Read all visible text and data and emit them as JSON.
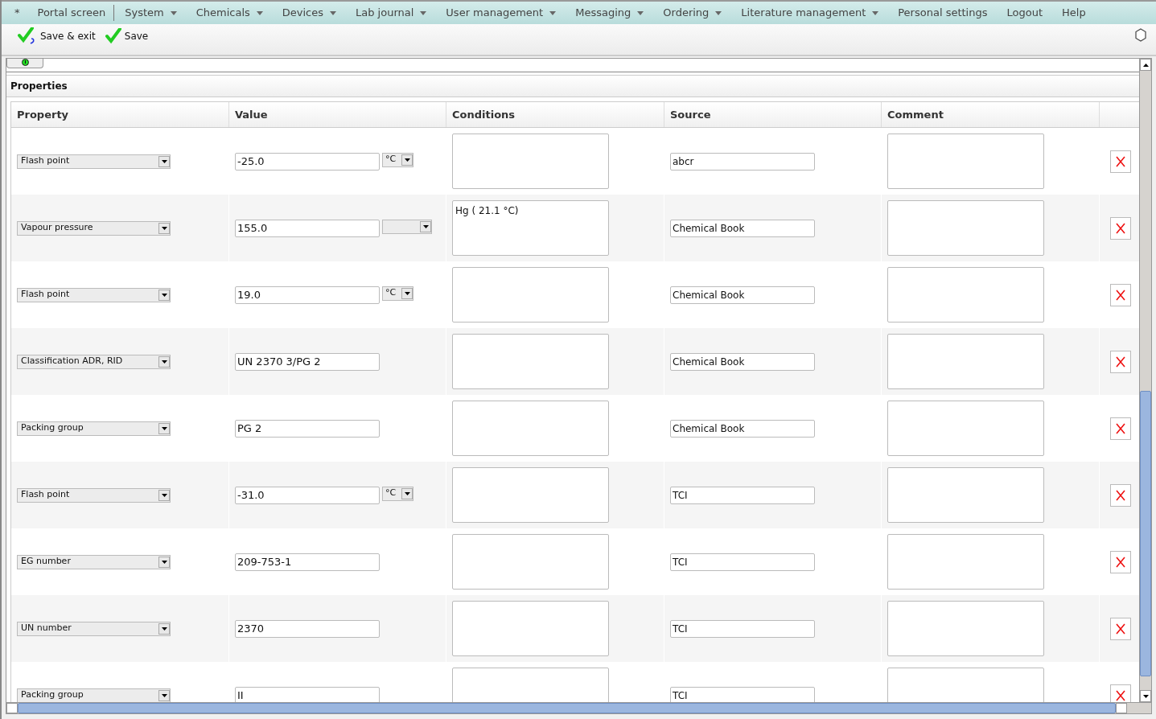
{
  "menu": [
    {
      "label": "*",
      "dropdown": false
    },
    {
      "label": "Portal screen",
      "dropdown": false
    },
    {
      "label": "System",
      "dropdown": true
    },
    {
      "label": "Chemicals",
      "dropdown": true
    },
    {
      "label": "Devices",
      "dropdown": true
    },
    {
      "label": "Lab journal",
      "dropdown": true
    },
    {
      "label": "User management",
      "dropdown": true
    },
    {
      "label": "Messaging",
      "dropdown": true
    },
    {
      "label": "Ordering",
      "dropdown": true
    },
    {
      "label": "Literature management",
      "dropdown": true
    },
    {
      "label": "Personal settings",
      "dropdown": false
    },
    {
      "label": "Logout",
      "dropdown": false
    },
    {
      "label": "Help",
      "dropdown": false
    }
  ],
  "toolbar": [
    {
      "label": "Save & exit",
      "kind": "save-exit"
    },
    {
      "label": "Save",
      "kind": "save"
    }
  ],
  "section": {
    "title": "Properties"
  },
  "table": {
    "columns": [
      "Property",
      "Value",
      "Conditions",
      "Source",
      "Comment"
    ],
    "rows": [
      {
        "property": "Flash point",
        "value": "-25.0",
        "unit_field": true,
        "unit": "°C",
        "source": "abcr"
      },
      {
        "property": "Vapour pressure",
        "value": "155.0",
        "unit_field": true,
        "conditions": "Hg ( 21.1 °C)",
        "source": "Chemical Book"
      },
      {
        "property": "Flash point",
        "value": "19.0",
        "unit_field": true,
        "unit": "°C",
        "source": "Chemical Book"
      },
      {
        "property": "Classification ADR, RID",
        "value": "UN 2370 3/PG 2",
        "unit_field": false,
        "source": "Chemical Book"
      },
      {
        "property": "Packing group",
        "value": "PG 2",
        "unit_field": false,
        "source": "Chemical Book"
      },
      {
        "property": "Flash point",
        "value": "-31.0",
        "unit_field": true,
        "unit": "°C",
        "source": "TCI"
      },
      {
        "property": "EG number",
        "value": "209-753-1",
        "unit_field": false,
        "source": "TCI"
      },
      {
        "property": "UN number",
        "value": "2370",
        "unit_field": false,
        "source": "TCI"
      },
      {
        "property": "Packing group",
        "value": "II",
        "unit_field": false,
        "source": "TCI"
      }
    ]
  }
}
